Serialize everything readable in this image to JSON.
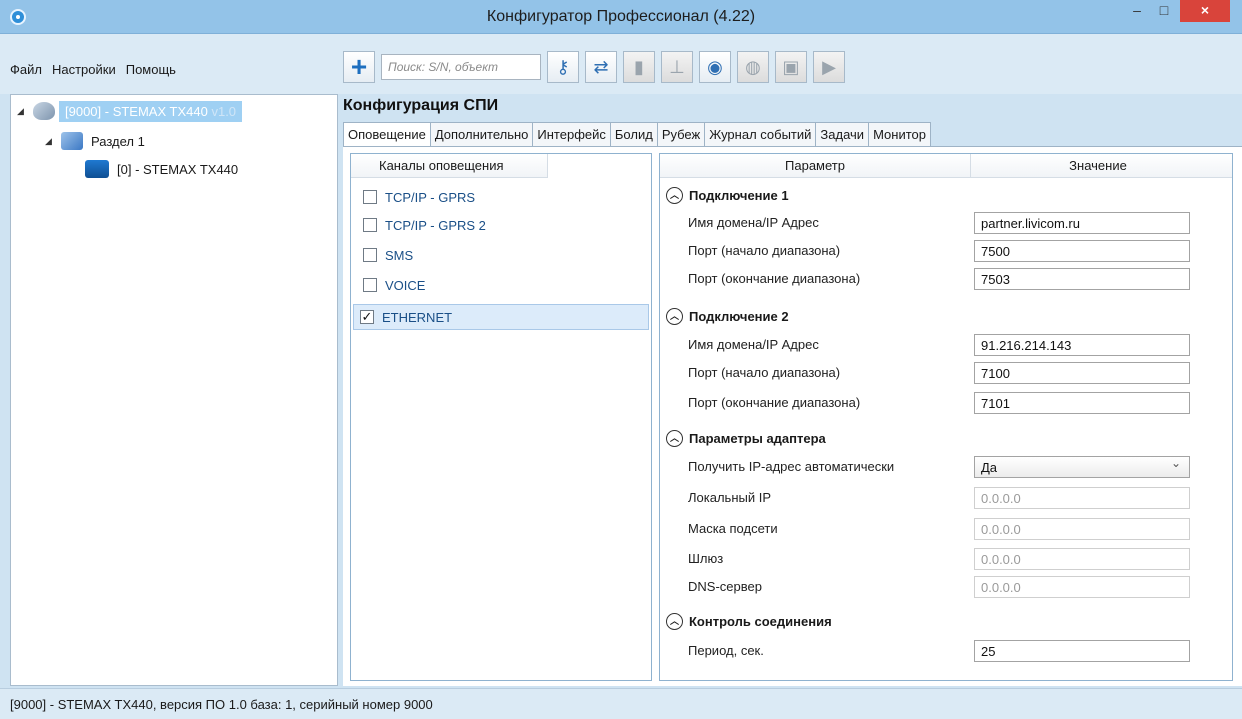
{
  "window": {
    "title": "Конфигуратор Профессионал (4.22)",
    "minimize": "–",
    "maximize": "□",
    "close": "×"
  },
  "menu": {
    "items": [
      "Файл",
      "Настройки",
      "Помощь"
    ]
  },
  "toolbar": {
    "search_placeholder": "Поиск: S/N, объект",
    "icons": [
      "add-icon",
      "search-key-icon",
      "connect-icon",
      "usb-icon",
      "modem-icon",
      "wifi-icon",
      "network-icon",
      "device-icon",
      "play-icon"
    ]
  },
  "tree": {
    "root": {
      "label": "[9000] - STEMAX TX440",
      "version": "v1.0"
    },
    "section": {
      "label": "Раздел 1"
    },
    "item": {
      "label": "[0] - STEMAX TX440"
    }
  },
  "config": {
    "title": "Конфигурация СПИ",
    "tabs": [
      "Оповещение",
      "Дополнительно",
      "Интерфейс",
      "Болид",
      "Рубеж",
      "Журнал событий",
      "Задачи",
      "Монитор"
    ],
    "active_tab": "Оповещение"
  },
  "channels": {
    "header": "Каналы оповещения",
    "items": [
      {
        "label": "TCP/IP - GPRS",
        "checked": false
      },
      {
        "label": "TCP/IP - GPRS 2",
        "checked": false
      },
      {
        "label": "SMS",
        "checked": false
      },
      {
        "label": "VOICE",
        "checked": false
      },
      {
        "label": "ETHERNET",
        "checked": true
      }
    ]
  },
  "params": {
    "col_param": "Параметр",
    "col_value": "Значение",
    "sections": [
      {
        "title": "Подключение 1",
        "rows": [
          {
            "label": "Имя домена/IP Адрес",
            "value": "partner.livicom.ru"
          },
          {
            "label": "Порт (начало диапазона)",
            "value": "7500"
          },
          {
            "label": "Порт (окончание диапазона)",
            "value": "7503"
          }
        ]
      },
      {
        "title": "Подключение 2",
        "rows": [
          {
            "label": "Имя домена/IP Адрес",
            "value": "91.216.214.143"
          },
          {
            "label": "Порт (начало диапазона)",
            "value": "7100"
          },
          {
            "label": "Порт (окончание диапазона)",
            "value": "7101"
          }
        ]
      },
      {
        "title": "Параметры адаптера",
        "rows": [
          {
            "label": "Получить IP-адрес автоматически",
            "value": "Да"
          },
          {
            "label": "Локальный IP",
            "value": "0.0.0.0"
          },
          {
            "label": "Маска подсети",
            "value": "0.0.0.0"
          },
          {
            "label": "Шлюз",
            "value": "0.0.0.0"
          },
          {
            "label": "DNS-сервер",
            "value": "0.0.0.0"
          }
        ]
      },
      {
        "title": "Контроль соединения",
        "rows": [
          {
            "label": "Период, сек.",
            "value": "25"
          }
        ]
      }
    ]
  },
  "status": {
    "text": "[9000] - STEMAX TX440, версия ПО 1.0 база: 1, серийный номер 9000"
  }
}
